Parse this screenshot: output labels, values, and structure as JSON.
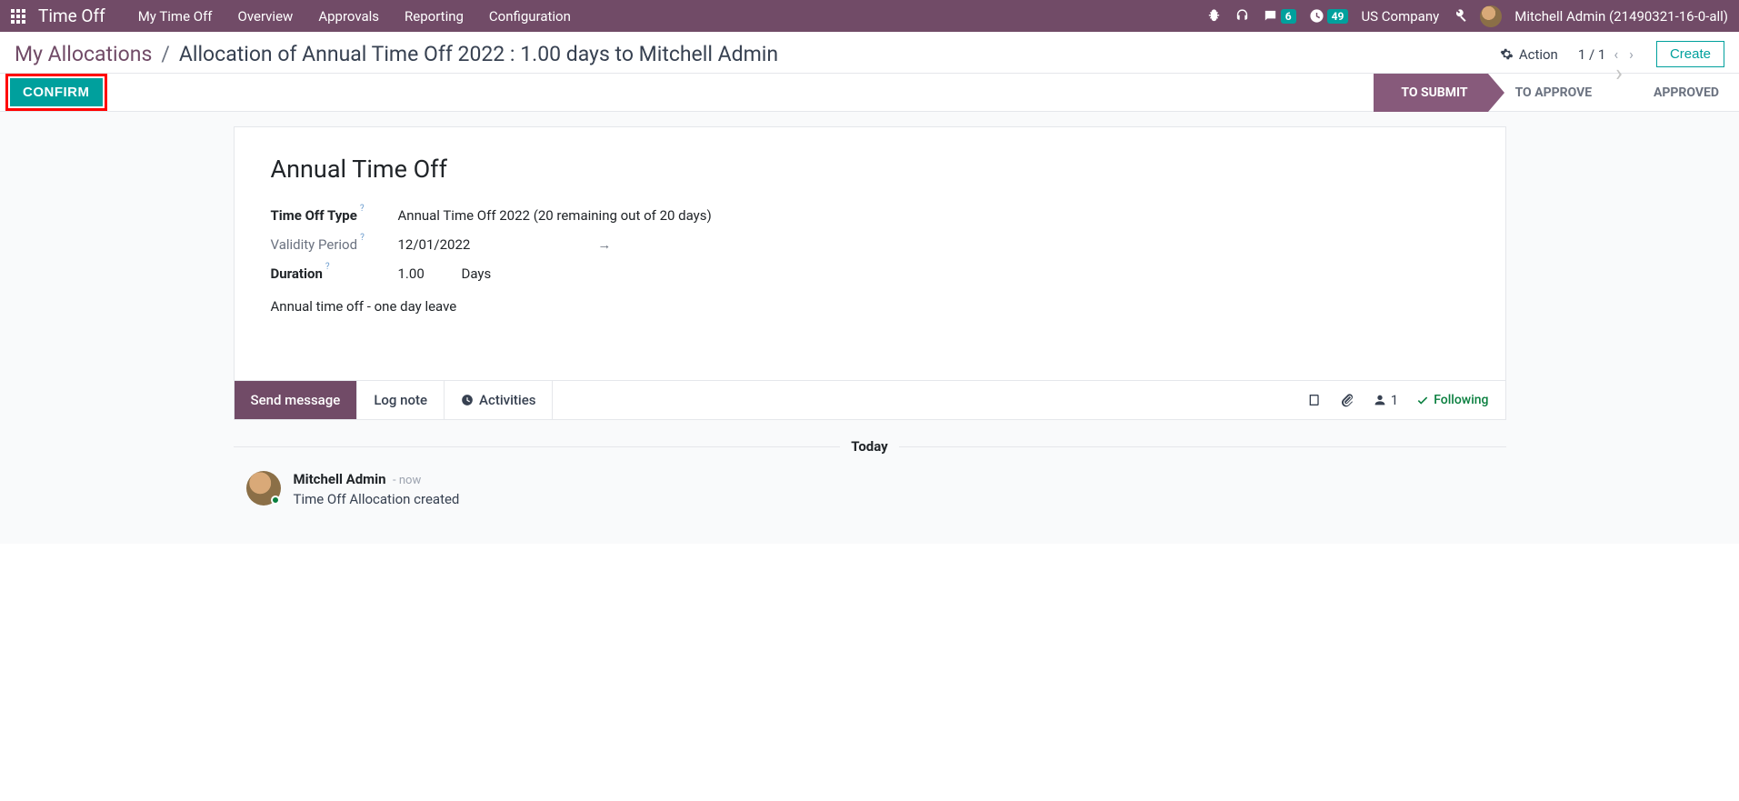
{
  "navbar": {
    "brand": "Time Off",
    "menu": [
      "My Time Off",
      "Overview",
      "Approvals",
      "Reporting",
      "Configuration"
    ],
    "chat_badge": "6",
    "clock_badge": "49",
    "company": "US Company",
    "user": "Mitchell Admin (21490321-16-0-all)"
  },
  "breadcrumb": {
    "root": "My Allocations",
    "current": "Allocation of Annual Time Off 2022 : 1.00 days to Mitchell Admin",
    "action_label": "Action",
    "pager": "1 / 1",
    "create_label": "Create"
  },
  "statusbar": {
    "confirm_label": "CONFIRM",
    "stages": [
      "TO SUBMIT",
      "TO APPROVE",
      "APPROVED"
    ]
  },
  "form": {
    "title": "Annual Time Off",
    "type_label": "Time Off Type",
    "type_value": "Annual Time Off 2022 (20 remaining out of 20 days)",
    "validity_label": "Validity Period",
    "validity_from": "12/01/2022",
    "duration_label": "Duration",
    "duration_value": "1.00",
    "duration_unit": "Days",
    "reason": "Annual time off - one day leave"
  },
  "chatter": {
    "send_label": "Send message",
    "log_label": "Log note",
    "activities_label": "Activities",
    "follower_count": "1",
    "following_label": "Following",
    "today_label": "Today",
    "message": {
      "author": "Mitchell Admin",
      "time": "now",
      "body": "Time Off Allocation created"
    }
  }
}
